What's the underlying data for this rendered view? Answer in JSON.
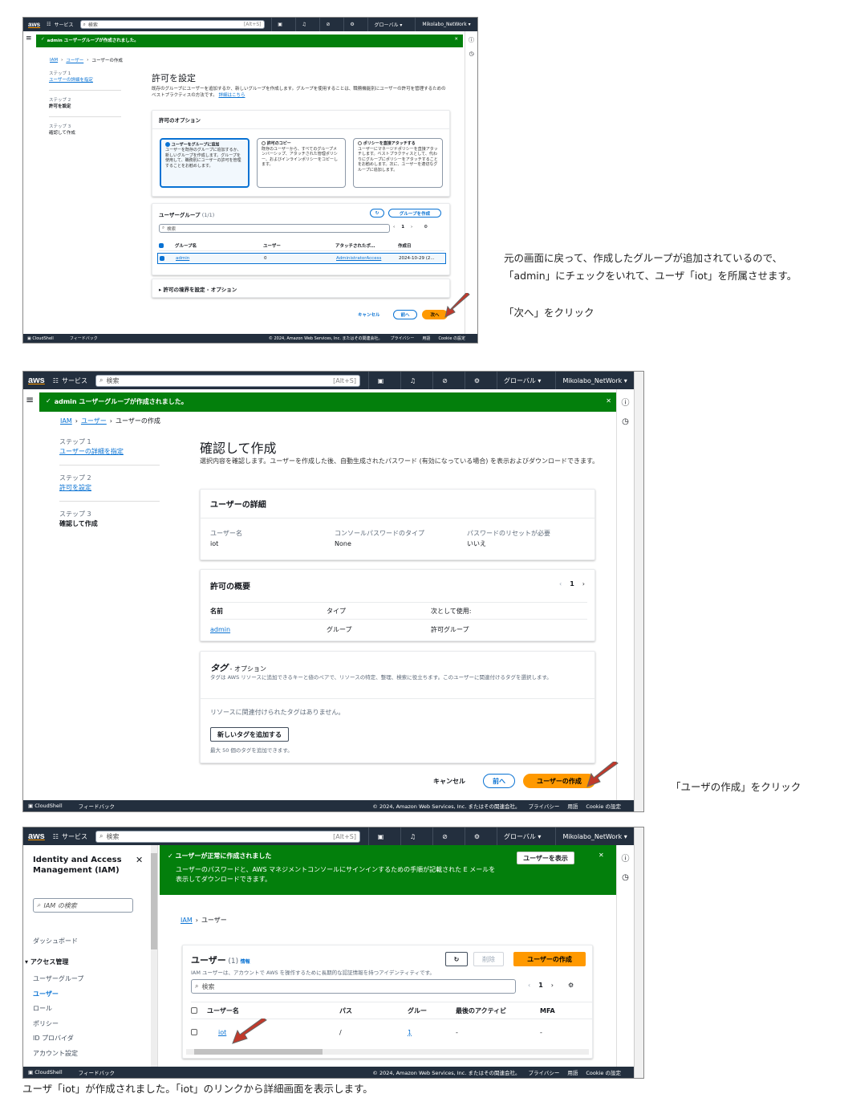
{
  "shot1": {
    "top": {
      "brand": "aws",
      "services": "サービス",
      "search_placeholder": "検索",
      "shortcut": "[Alt+S]",
      "region": "グローバル ▾",
      "account": "Mikolabo_NetWork ▾"
    },
    "flash": "admin ユーザーグループが作成されました。",
    "breadcrumb": {
      "iam": "IAM",
      "users": "ユーザー",
      "current": "ユーザーの作成"
    },
    "steps": [
      {
        "n": "ステップ 1",
        "t": "ユーザーの詳細を指定"
      },
      {
        "n": "ステップ 2",
        "t": "許可を設定"
      },
      {
        "n": "ステップ 3",
        "t": "確認して作成"
      }
    ],
    "title": "許可を設定",
    "desc": "既存のグループにユーザーを追加するか、新しいグループを作成します。グループを使用することは、職務機能別にユーザーの許可を管理するためのベストプラクティスの方法です。",
    "desc_link": "詳細はこちら",
    "options_title": "許可のオプション",
    "options": [
      {
        "t": "ユーザーをグループに追加",
        "d": "ユーザーを既存のグループに追加するか、新しいグループを作成します。グループを使用して、職務別にユーザーの許可を管理することをお勧めします。"
      },
      {
        "t": "許可のコピー",
        "d": "既存のユーザーから、すべてのグループメンバーシップ、アタッチされた管理ポリシー、およびインラインポリシーをコピーします。"
      },
      {
        "t": "ポリシーを直接アタッチする",
        "d": "ユーザーにマネージドポリシーを直接アタッチします。ベストプラクティスとして、代わりにグループにポリシーをアタッチすることをお勧めします。次に、ユーザーを適切なグループに追加します。"
      }
    ],
    "groups_title": "ユーザーグループ",
    "groups_count": "(1/1)",
    "create_group": "グループを作成",
    "search": "検索",
    "page": "1",
    "cols": [
      "グループ名",
      "ユーザー",
      "アタッチされたポ…",
      "作成日"
    ],
    "row": {
      "name": "admin",
      "users": "0",
      "policy": "AdministratorAccess",
      "date": "2024-10-29 (2..."
    },
    "boundary": "許可の境界を設定 - オプション",
    "cancel": "キャンセル",
    "prev": "前へ",
    "next": "次へ",
    "footer": {
      "cloudshell": "CloudShell",
      "feedback": "フィードバック",
      "copy": "© 2024, Amazon Web Services, Inc. またはその関連会社。",
      "privacy": "プライバシー",
      "terms": "用語",
      "cookie": "Cookie の設定"
    }
  },
  "note1": {
    "line1": "元の画面に戻って、作成したグループが追加されているので、",
    "line2": "「admin」にチェックをいれて、ユーザ「iot」を所属させます。",
    "line3": "「次へ」をクリック"
  },
  "shot2": {
    "title": "確認して作成",
    "desc": "選択内容を確認します。ユーザーを作成した後、自動生成されたパスワード (有効になっている場合) を表示およびダウンロードできます。",
    "details_title": "ユーザーの詳細",
    "details": [
      {
        "k": "ユーザー名",
        "v": "iot"
      },
      {
        "k": "コンソールパスワードのタイプ",
        "v": "None"
      },
      {
        "k": "パスワードのリセットが必要",
        "v": "いいえ"
      }
    ],
    "perm_title": "許可の概要",
    "page": "1",
    "perm_cols": [
      "名前",
      "タイプ",
      "次として使用:"
    ],
    "perm_row": {
      "name": "admin",
      "type": "グループ",
      "use": "許可グループ"
    },
    "tags_title": "タグ",
    "tags_opt": "- オプション",
    "tags_desc": "タグは AWS リソースに追加できるキーと値のペアで、リソースの特定、整理、検索に役立ちます。このユーザーに関連付けるタグを選択します。",
    "no_tags": "リソースに関連付けられたタグはありません。",
    "add_tag": "新しいタグを追加する",
    "tag_limit": "最大 50 個のタグを追加できます。",
    "create_user": "ユーザーの作成"
  },
  "note2": "「ユーザの作成」をクリック",
  "shot3": {
    "nav_title": "Identity and Access Management (IAM)",
    "nav_search": "IAM の検索",
    "nav_dashboard": "ダッシュボード",
    "nav_access": "アクセス管理",
    "nav_items": [
      "ユーザーグループ",
      "ユーザー",
      "ロール",
      "ポリシー",
      "ID プロバイダ",
      "アカウント設定"
    ],
    "flash_title": "ユーザーが正常に作成されました",
    "flash_body": "ユーザーのパスワードと、AWS マネジメントコンソールにサインインするための手順が記載された E メールを表示してダウンロードできます。",
    "view_user": "ユーザーを表示",
    "bc_current": "ユーザー",
    "users_title": "ユーザー",
    "users_count": "(1)",
    "info": "情報",
    "users_desc": "IAM ユーザーは、アカウントで AWS を操作するために長期的な認証情報を持つアイデンティティです。",
    "delete": "削除",
    "cols": [
      "ユーザー名",
      "パス",
      "グルー",
      "最後のアクティビ",
      "MFA"
    ],
    "row": {
      "name": "iot",
      "path": "/",
      "groups": "1",
      "last": "-",
      "mfa": "-"
    }
  },
  "note3": "ユーザ「iot」が作成されました。「iot」のリンクから詳細画面を表示します。"
}
